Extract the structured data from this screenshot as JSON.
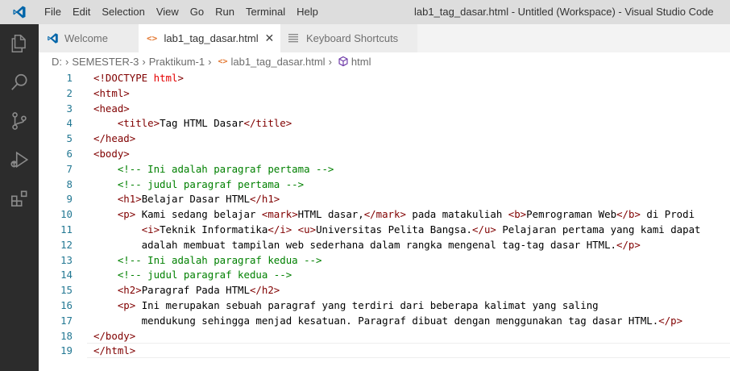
{
  "titlebar": {
    "menu": [
      "File",
      "Edit",
      "Selection",
      "View",
      "Go",
      "Run",
      "Terminal",
      "Help"
    ],
    "window_title": "lab1_tag_dasar.html - Untitled (Workspace) - Visual Studio Code"
  },
  "tabs": [
    {
      "label": "Welcome",
      "icon": "vscode-icon",
      "active": false
    },
    {
      "label": "lab1_tag_dasar.html",
      "icon": "html-file-icon",
      "active": true
    },
    {
      "label": "Keyboard Shortcuts",
      "icon": "keyboard-shortcuts-icon",
      "active": false
    }
  ],
  "breadcrumb": {
    "drive": "D:",
    "folder1": "SEMESTER-3",
    "folder2": "Praktikum-1",
    "file": "lab1_tag_dasar.html",
    "symbol": "html"
  },
  "editor": {
    "lines": [
      "<!DOCTYPE html>",
      "<html>",
      "<head>",
      "    <title>Tag HTML Dasar</title>",
      "</head>",
      "<body>",
      "    <!-- Ini adalah paragraf pertama -->",
      "    <!-- judul paragraf pertama -->",
      "    <h1>Belajar Dasar HTML</h1>",
      "    <p> Kami sedang belajar <mark>HTML dasar,</mark> pada matakuliah <b>Pemrograman Web</b> di Prodi",
      "        <i>Teknik Informatika</i> <u>Universitas Pelita Bangsa.</u> Pelajaran pertama yang kami dapat",
      "        adalah membuat tampilan web sederhana dalam rangka mengenal tag-tag dasar HTML.</p>",
      "    <!-- Ini adalah paragraf kedua -->",
      "    <!-- judul paragraf kedua -->",
      "    <h2>Paragraf Pada HTML</h2>",
      "    <p> Ini merupakan sebuah paragraf yang terdiri dari beberapa kalimat yang saling",
      "        mendukung sehingga menjad kesatuan. Paragraf dibuat dengan menggunakan tag dasar HTML.</p>",
      "</body>",
      "</html>"
    ],
    "line_numbers": [
      "1",
      "2",
      "3",
      "4",
      "5",
      "6",
      "7",
      "8",
      "9",
      "10",
      "11",
      "12",
      "13",
      "14",
      "15",
      "16",
      "17",
      "18",
      "19"
    ],
    "current_line": 19
  },
  "colors": {
    "activitybar": "#2c2c2c",
    "titlebar": "#dddddd",
    "tag": "#800000",
    "comment": "#008000",
    "line_number": "#237893",
    "vscode_blue": "#0065a9"
  }
}
